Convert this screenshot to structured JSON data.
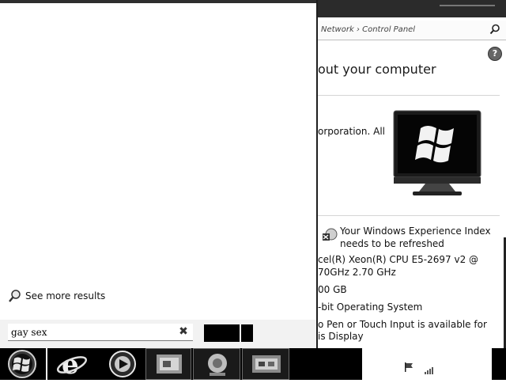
{
  "background_window": {
    "address_text": "Network › Control Panel",
    "heading": "out your computer",
    "copyright_text": "orporation.  All",
    "wei_link": "Your Windows Experience Index needs to be refreshed",
    "specs": [
      {
        "text": "cel(R) Xeon(R) CPU E5-2697 v2 @"
      },
      {
        "text": "70GHz   2.70 GHz"
      },
      {
        "text": "00 GB"
      },
      {
        "text": "-bit Operating System"
      },
      {
        "text": "o Pen or Touch Input is available for"
      },
      {
        "text": "is Display"
      }
    ],
    "icons": {
      "search": "search-icon",
      "help": "help-icon",
      "monitor": "windows-monitor-logo",
      "wei": "windows-experience-index-icon"
    }
  },
  "start_menu": {
    "see_more_label": "See more results",
    "search_value": "gay sex",
    "clear_symbol": "✖",
    "icons": {
      "see_more": "magnifier-icon",
      "clear": "close-icon"
    }
  },
  "taskbar": {
    "items": [
      {
        "name": "start-orb"
      },
      {
        "name": "internet-explorer"
      },
      {
        "name": "media-player"
      },
      {
        "name": "pinned-app-1"
      },
      {
        "name": "pinned-app-2"
      },
      {
        "name": "pinned-app-3"
      }
    ]
  },
  "colors": {
    "dark": "#000000",
    "window_bg": "#ffffff",
    "search_row_bg": "#f2f2f2"
  }
}
